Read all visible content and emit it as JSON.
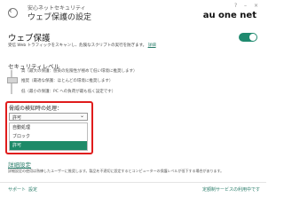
{
  "header": {
    "subtitle": "安心ネットセキュリティ",
    "title": "ウェブ保護の設定",
    "window_controls": "? – ×",
    "brand": "au one net"
  },
  "protection": {
    "title": "ウェブ保護",
    "description": "受信 Web トラフィックをスキャンし、危険なスクリプトの実行を防ぎます。",
    "description_link": "詳細",
    "enabled": true
  },
  "security_level": {
    "label": "セキュリティレベル",
    "levels": [
      "高（最大の保護：感染の危険性が極めて低い環境に推奨します）",
      "推奨（最適な保護：ほとんどの環境に推奨します）",
      "低（最小の保護：PC への負荷が最も低く設定です）"
    ]
  },
  "threat_action": {
    "label": "脅威の検知時の処理：",
    "selected": "許可",
    "options": [
      "自動処理",
      "ブロック",
      "許可"
    ]
  },
  "advanced": {
    "link": "詳細設定",
    "description": "詳細設定の使用は熟練したユーザーに推奨します。製品を不適切に設定するとコンピューターの保護レベルが低下する場合があります。"
  },
  "footer": {
    "support": "サポート",
    "settings": "設定",
    "remote": "定額制サービスの利用中です"
  }
}
